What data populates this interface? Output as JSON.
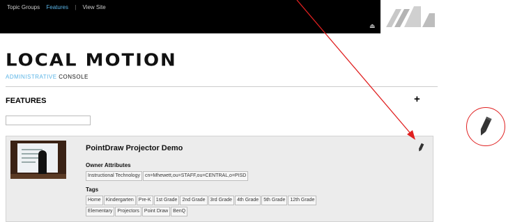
{
  "nav": {
    "items": [
      {
        "label": "Topic Groups",
        "active": false
      },
      {
        "label": "Features",
        "active": true
      },
      {
        "label": "View Site",
        "active": false
      }
    ],
    "separator": "|",
    "exit_icon": "exit-icon"
  },
  "brand": {
    "title": "LOCAL MOTION",
    "subtitle_accent": "ADMINISTRATIVE",
    "subtitle_rest": "CONSOLE"
  },
  "features": {
    "title": "FEATURES",
    "add_label": "+",
    "filter_value": ""
  },
  "card": {
    "title": "PointDraw Projector Demo",
    "owner_label": "Owner Attributes",
    "owner_attributes": [
      "Instructional Technology",
      "cn=Mhewett,ou=STAFF,ou=CENTRAL,o=PISD"
    ],
    "tags_label": "Tags",
    "tags": [
      "Home",
      "Kindergarten",
      "Pre-K",
      "1st Grade",
      "2nd Grade",
      "3rd Grade",
      "4th Grade",
      "5th Grade",
      "12th Grade",
      "Elementary",
      "Projectors",
      "Point Draw",
      "BenQ"
    ],
    "edit_icon": "pencil-icon"
  },
  "colors": {
    "accent": "#5ab4e6",
    "topbar": "#000000",
    "callout": "#e02020"
  }
}
